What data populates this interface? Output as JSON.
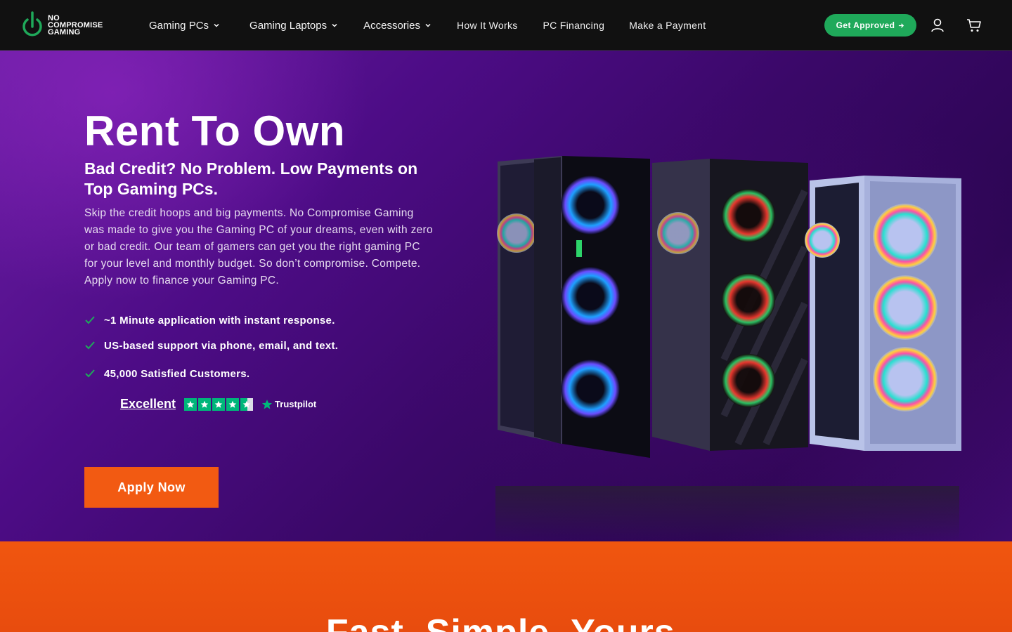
{
  "brand": {
    "logo_line1": "NO",
    "logo_line2": "COMPROMISE",
    "logo_line3": "GAMING",
    "accent": "#1fa95a"
  },
  "nav": {
    "items": [
      {
        "label": "Gaming PCs",
        "dropdown": true
      },
      {
        "label": "Gaming Laptops",
        "dropdown": true
      },
      {
        "label": "Accessories",
        "dropdown": true
      },
      {
        "label": "How It Works",
        "dropdown": false
      },
      {
        "label": "PC Financing",
        "dropdown": false
      },
      {
        "label": "Make a Payment",
        "dropdown": false
      }
    ],
    "cta": "Get Approved",
    "icons": [
      "user-icon",
      "cart-icon"
    ]
  },
  "hero": {
    "title": "Rent To Own",
    "subtitle": "Bad Credit? No Problem. Low Payments on Top Gaming PCs.",
    "body": "Skip the credit hoops and big payments. No Compromise Gaming was made to give you the Gaming PC of your dreams, even with zero or bad credit. Our team of gamers can get you the right gaming PC for your level and monthly budget. So don’t compromise. Compete. Apply now to finance your Gaming PC.",
    "features": [
      "~1 Minute application with instant response.",
      "US-based support via phone, email, and text.",
      "45,000 Satisfied Customers."
    ],
    "trustpilot": {
      "rating_label": "Excellent",
      "stars": 4.5,
      "brand": "Trustpilot"
    },
    "apply_label": "Apply Now",
    "colors": {
      "apply": "#f25a12",
      "check": "#1fa95a"
    }
  },
  "section2": {
    "title": "Fast. Simple. Yours."
  }
}
